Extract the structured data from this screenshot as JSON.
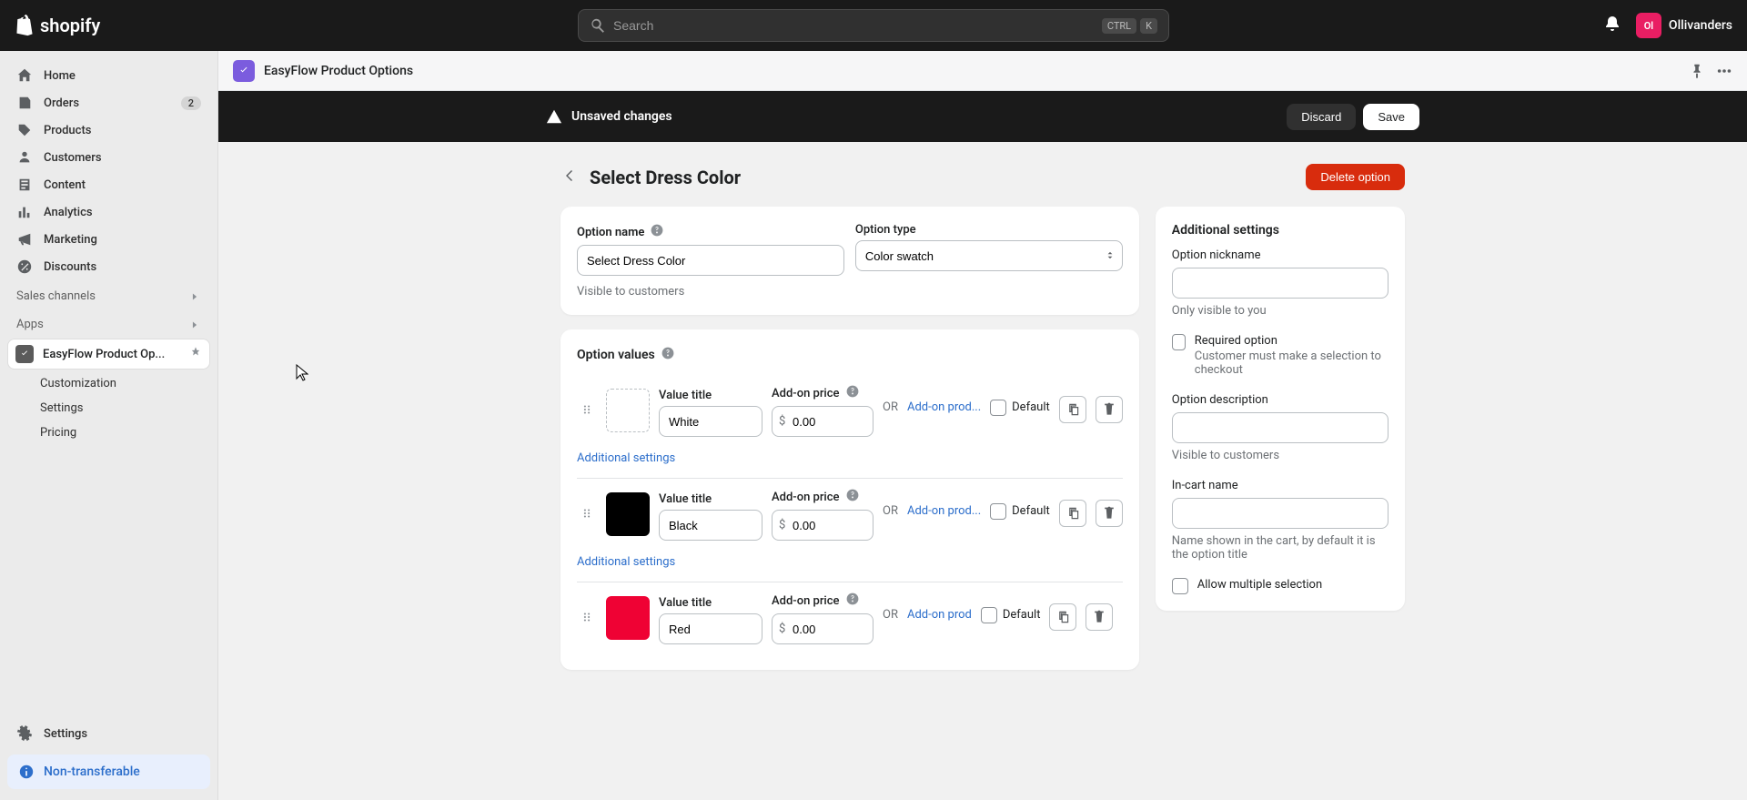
{
  "topbar": {
    "logo_text": "shopify",
    "search_placeholder": "Search",
    "kbd_ctrl": "CTRL",
    "kbd_k": "K",
    "user_initials": "Ol",
    "user_name": "Ollivanders"
  },
  "sidebar": {
    "home": "Home",
    "orders": "Orders",
    "orders_badge": "2",
    "products": "Products",
    "customers": "Customers",
    "content": "Content",
    "analytics": "Analytics",
    "marketing": "Marketing",
    "discounts": "Discounts",
    "sales_channels": "Sales channels",
    "apps": "Apps",
    "app_name": "EasyFlow Product Op...",
    "sub_customization": "Customization",
    "sub_settings": "Settings",
    "sub_pricing": "Pricing",
    "settings": "Settings",
    "non_transferable": "Non-transferable"
  },
  "app_header": {
    "title": "EasyFlow Product Options"
  },
  "savebar": {
    "text": "Unsaved changes",
    "discard": "Discard",
    "save": "Save"
  },
  "page": {
    "title": "Select Dress Color",
    "delete_option": "Delete option"
  },
  "option": {
    "name_label": "Option name",
    "name_value": "Select Dress Color",
    "name_helper": "Visible to customers",
    "type_label": "Option type",
    "type_value": "Color swatch"
  },
  "values": {
    "heading": "Option values",
    "value_title_label": "Value title",
    "addon_label": "Add-on price",
    "or": "OR",
    "addon_link": "Add-on prod...",
    "addon_link_short": "Add-on prod",
    "default_label": "Default",
    "additional_settings": "Additional settings",
    "currency": "$",
    "rows": [
      {
        "title": "White",
        "price": "0.00",
        "swatch": "white"
      },
      {
        "title": "Black",
        "price": "0.00",
        "swatch": "black"
      },
      {
        "title": "Red",
        "price": "0.00",
        "swatch": "red"
      }
    ]
  },
  "side": {
    "heading": "Additional settings",
    "nickname_label": "Option nickname",
    "nickname_helper": "Only visible to you",
    "required_label": "Required option",
    "required_desc": "Customer must make a selection to checkout",
    "description_label": "Option description",
    "description_helper": "Visible to customers",
    "incart_label": "In-cart name",
    "incart_helper": "Name shown in the cart, by default it is the option title",
    "allow_multiple_label": "Allow multiple selection"
  }
}
